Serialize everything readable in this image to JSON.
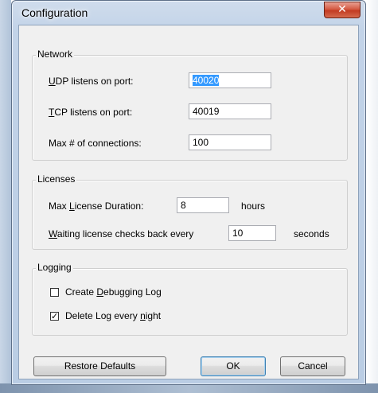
{
  "window": {
    "title": "Configuration",
    "close_glyph": "✕"
  },
  "network": {
    "legend": "Network",
    "udp": {
      "label_accel": "U",
      "label_rest": "DP listens on port:",
      "value": "40020"
    },
    "tcp": {
      "label_accel": "T",
      "label_rest": "CP listens on port:",
      "value": "40019"
    },
    "maxconn": {
      "label_pre": "Max # of connections:",
      "value": "100"
    }
  },
  "licenses": {
    "legend": "Licenses",
    "duration": {
      "label_pre": "Max ",
      "label_accel": "L",
      "label_rest": "icense Duration:",
      "value": "8",
      "unit": "hours"
    },
    "waiting": {
      "label_accel": "W",
      "label_rest": "aiting license checks back every",
      "value": "10",
      "unit": "seconds"
    }
  },
  "logging": {
    "legend": "Logging",
    "debug": {
      "label_pre": "Create ",
      "label_accel": "D",
      "label_rest": "ebugging Log",
      "checked": false
    },
    "delete": {
      "label_pre": "Delete Log every ",
      "label_accel": "n",
      "label_rest": "ight",
      "checked": true,
      "check_glyph": "✓"
    }
  },
  "buttons": {
    "restore": "Restore Defaults",
    "ok": "OK",
    "cancel": "Cancel"
  }
}
